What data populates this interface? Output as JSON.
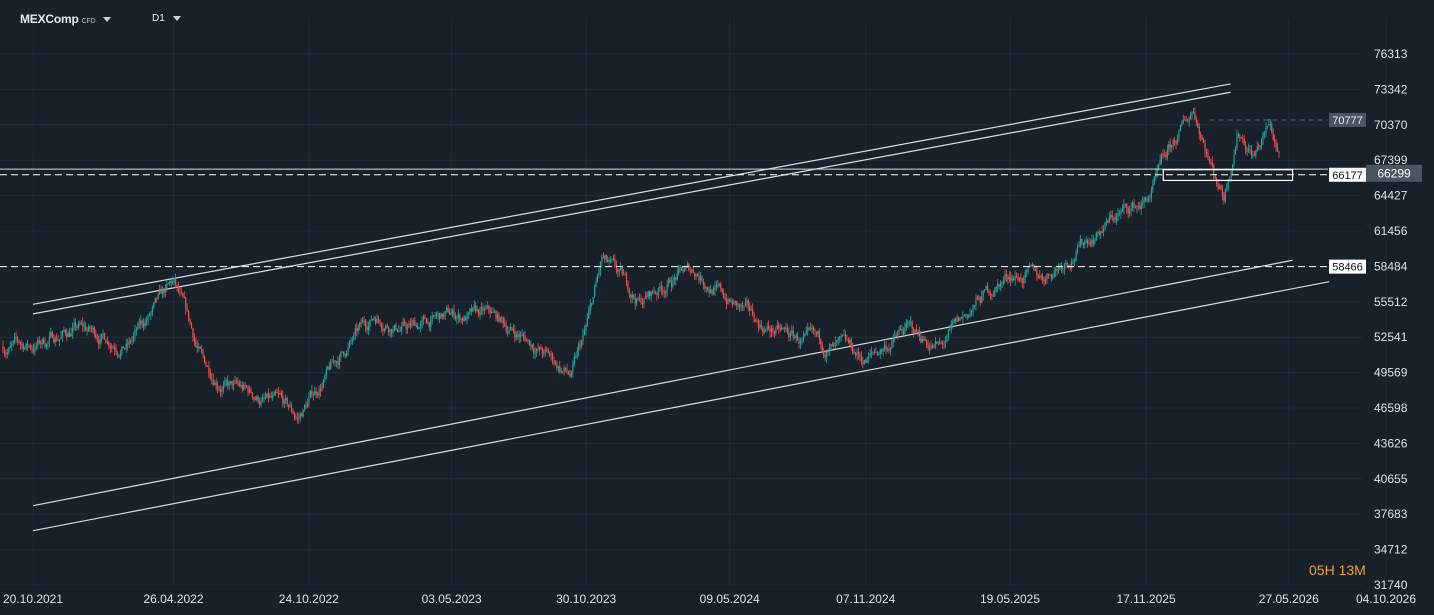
{
  "header": {
    "symbol": "MEXComp",
    "instrument_type": "CFD",
    "timeframe": "D1"
  },
  "countdown": {
    "hours": "05",
    "h": "H",
    "minutes": "13",
    "m": "M"
  },
  "colors": {
    "background": "#18202a",
    "bull": "#26a69a",
    "bear": "#ef5350",
    "grid": "#222c37",
    "lines": "#d8dde3"
  },
  "chart_data": {
    "type": "candlestick",
    "y_ticks": [
      "76313",
      "73342",
      "70370",
      "67399",
      "64427",
      "61456",
      "58484",
      "55512",
      "52541",
      "49569",
      "46598",
      "43626",
      "40655",
      "37683",
      "34712",
      "31740"
    ],
    "x_ticks": [
      "20.10.2021",
      "26.04.2022",
      "24.10.2022",
      "03.05.2023",
      "30.10.2023",
      "09.05.2024",
      "07.11.2024",
      "19.05.2025",
      "17.11.2025",
      "27.05.2026",
      "04.10.2026"
    ],
    "ylim": [
      31740,
      76313
    ],
    "price_labels": [
      {
        "text": "70777",
        "value": 70777,
        "style": "gray"
      },
      {
        "text": "66177",
        "value": 66177,
        "style": "white"
      },
      {
        "text": "66299",
        "value": 66299,
        "style": "current"
      },
      {
        "text": "58466",
        "value": 58466,
        "style": "white"
      }
    ],
    "horizontal_levels": [
      66177,
      58466
    ],
    "price_path": [
      [
        "20.10.2021",
        51800
      ],
      [
        "15.12.2021",
        53300
      ],
      [
        "25.02.2022",
        52000
      ],
      [
        "26.04.2022",
        56800
      ],
      [
        "05.06.2022",
        50200
      ],
      [
        "10.07.2022",
        48400
      ],
      [
        "15.09.2022",
        46700
      ],
      [
        "10.10.2022",
        45600
      ],
      [
        "24.10.2022",
        47200
      ],
      [
        "15.12.2022",
        51700
      ],
      [
        "20.01.2023",
        54400
      ],
      [
        "05.03.2023",
        53300
      ],
      [
        "03.05.2023",
        54300
      ],
      [
        "25.06.2023",
        54200
      ],
      [
        "20.08.2023",
        52000
      ],
      [
        "10.10.2023",
        49200
      ],
      [
        "30.10.2023",
        53000
      ],
      [
        "20.11.2023",
        58800
      ],
      [
        "10.01.2024",
        55500
      ],
      [
        "01.03.2024",
        57800
      ],
      [
        "25.03.2024",
        58100
      ],
      [
        "09.05.2024",
        55500
      ],
      [
        "20.06.2024",
        53500
      ],
      [
        "01.09.2024",
        51700
      ],
      [
        "15.10.2024",
        51200
      ],
      [
        "07.11.2024",
        50500
      ],
      [
        "01.01.2025",
        53200
      ],
      [
        "15.02.2025",
        51600
      ],
      [
        "10.04.2025",
        55700
      ],
      [
        "19.05.2025",
        57900
      ],
      [
        "01.07.2025",
        57500
      ],
      [
        "01.09.2025",
        60900
      ],
      [
        "10.10.2025",
        62800
      ],
      [
        "17.11.2025",
        63900
      ],
      [
        "15.12.2025",
        67500
      ],
      [
        "20.01.2026",
        71700
      ],
      [
        "01.02.2026",
        69400
      ],
      [
        "15.02.2026",
        66500
      ],
      [
        "01.03.2026",
        64600
      ],
      [
        "20.03.2026",
        70200
      ],
      [
        "10.04.2026",
        68000
      ],
      [
        "01.05.2026",
        70200
      ],
      [
        "15.05.2026",
        67800
      ]
    ],
    "trendlines": [
      {
        "name": "upper channel A",
        "from": [
          "20.10.2021",
          55300
        ],
        "to": [
          "10.03.2026",
          73800
        ]
      },
      {
        "name": "upper channel B",
        "from": [
          "20.10.2021",
          54500
        ],
        "to": [
          "10.03.2026",
          73100
        ]
      },
      {
        "name": "lower channel A",
        "from": [
          "20.10.2021",
          38400
        ],
        "to": [
          "01.06.2026",
          59000
        ]
      },
      {
        "name": "lower channel B",
        "from": [
          "20.10.2021",
          36300
        ],
        "to": [
          "20.07.2026",
          57200
        ]
      }
    ],
    "box": {
      "from": [
        "10.12.2025",
        66600
      ],
      "to": [
        "01.06.2026",
        65700
      ]
    },
    "grid": true
  }
}
